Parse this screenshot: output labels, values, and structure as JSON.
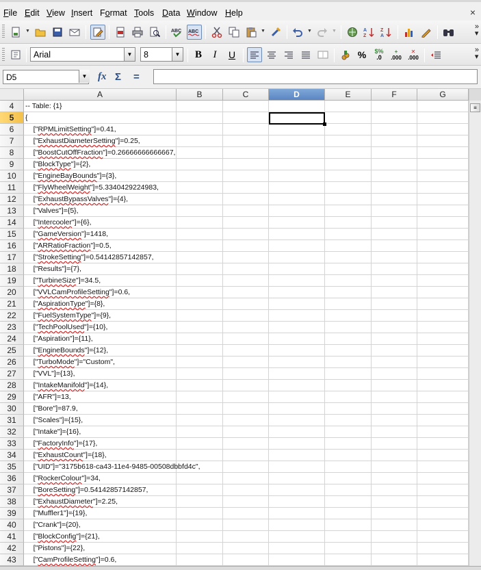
{
  "menu": [
    "File",
    "Edit",
    "View",
    "Insert",
    "Format",
    "Tools",
    "Data",
    "Window",
    "Help"
  ],
  "menu_accel": [
    "F",
    "E",
    "V",
    "I",
    "o",
    "T",
    "D",
    "W",
    "H"
  ],
  "window_close": "×",
  "toolbar_standard": {
    "icons": [
      "new-document-icon",
      "open-folder-icon",
      "save-icon",
      "email-icon",
      "edit-mode-icon",
      "export-pdf-icon",
      "print-icon",
      "print-preview-icon",
      "spellcheck-icon",
      "autospellcheck-icon",
      "cut-icon",
      "copy-icon",
      "paste-icon",
      "clone-formatting-icon",
      "undo-icon",
      "redo-icon",
      "hyperlink-icon",
      "sort-ascending-icon",
      "sort-descending-icon",
      "chart-icon",
      "draw-functions-icon",
      "find-icon"
    ]
  },
  "toolbar_format": {
    "font_name": "Arial",
    "font_size": "8",
    "bold": "B",
    "italic": "I",
    "underline": "U",
    "currency": "%",
    "percent_label": "%",
    "decimal_add": ".000",
    "decimal_del": ".000"
  },
  "formula_bar": {
    "name_box": "D5",
    "fx": "fx",
    "sum": "Σ",
    "equals": "=",
    "content": ""
  },
  "columns": [
    "A",
    "B",
    "C",
    "D",
    "E",
    "F",
    "G"
  ],
  "active_column": "D",
  "active_row": "5",
  "rows": [
    {
      "n": "4",
      "key": "",
      "text": "-- Table: {1}"
    },
    {
      "n": "5",
      "key": "",
      "text": "{"
    },
    {
      "n": "6",
      "key": "RPMLimitSetting",
      "text": "]=0.41,"
    },
    {
      "n": "7",
      "key": "ExhaustDiameterSetting",
      "text": "]=0.25,"
    },
    {
      "n": "8",
      "key": "BoostCutOffFraction",
      "text": "]=0.26666666666667,"
    },
    {
      "n": "9",
      "key": "BlockType",
      "text": "]={2},"
    },
    {
      "n": "10",
      "key": "EngineBayBounds",
      "text": "]={3},"
    },
    {
      "n": "11",
      "key": "FlyWheelWeight",
      "text": "]=5.3340429224983,"
    },
    {
      "n": "12",
      "key": "ExhaustBypassValves",
      "text": "]={4},"
    },
    {
      "n": "13",
      "key": "",
      "text": "[\"Valves\"]={5},"
    },
    {
      "n": "14",
      "key": "Intercooler",
      "text": "]={6},"
    },
    {
      "n": "15",
      "key": "GameVersion",
      "text": "]=1418,"
    },
    {
      "n": "16",
      "key": "ARRatioFraction",
      "text": "]=0.5,"
    },
    {
      "n": "17",
      "key": "StrokeSetting",
      "text": "]=0.54142857142857,"
    },
    {
      "n": "18",
      "key": "",
      "text": "[\"Results\"]={7},"
    },
    {
      "n": "19",
      "key": "TurbineSize",
      "text": "]=34.5,"
    },
    {
      "n": "20",
      "key": "VVLCamProfileSetting",
      "text": "]=0.6,"
    },
    {
      "n": "21",
      "key": "AspirationType",
      "text": "]={8},"
    },
    {
      "n": "22",
      "key": "FuelSystemType",
      "text": "]={9},"
    },
    {
      "n": "23",
      "key": "TechPoolUsed",
      "text": "]={10},"
    },
    {
      "n": "24",
      "key": "",
      "text": "[\"Aspiration\"]={11},"
    },
    {
      "n": "25",
      "key": "EngineBounds",
      "text": "]={12},"
    },
    {
      "n": "26",
      "key": "TurboMode",
      "text": "]=\"Custom\","
    },
    {
      "n": "27",
      "key": "",
      "text": "[\"VVL\"]={13},"
    },
    {
      "n": "28",
      "key": "IntakeManifold",
      "text": "]={14},"
    },
    {
      "n": "29",
      "key": "",
      "text": "[\"AFR\"]=13,"
    },
    {
      "n": "30",
      "key": "",
      "text": "[\"Bore\"]=87.9,"
    },
    {
      "n": "31",
      "key": "",
      "text": "[\"Scales\"]={15},"
    },
    {
      "n": "32",
      "key": "",
      "text": "[\"Intake\"]={16},"
    },
    {
      "n": "33",
      "key": "FactoryInfo",
      "text": "]={17},"
    },
    {
      "n": "34",
      "key": "ExhaustCount",
      "text": "]={18},"
    },
    {
      "n": "35",
      "key": "",
      "text": "[\"UID\"]=\"3175b618-ca43-11e4-9485-00508dbbfd4c\","
    },
    {
      "n": "36",
      "key": "RockerColour",
      "text": "]=34,"
    },
    {
      "n": "37",
      "key": "BoreSetting",
      "text": "]=0.54142857142857,"
    },
    {
      "n": "38",
      "key": "ExhaustDiameter",
      "text": "]=2.25,"
    },
    {
      "n": "39",
      "key": "",
      "text": "[\"Muffler1\"]={19},"
    },
    {
      "n": "40",
      "key": "",
      "text": "[\"Crank\"]={20},"
    },
    {
      "n": "41",
      "key": "BlockConfig",
      "text": "]={21},"
    },
    {
      "n": "42",
      "key": "",
      "text": "[\"Pistons\"]={22},"
    },
    {
      "n": "43",
      "key": "CamProfileSetting",
      "text": "]=0.6,"
    }
  ]
}
